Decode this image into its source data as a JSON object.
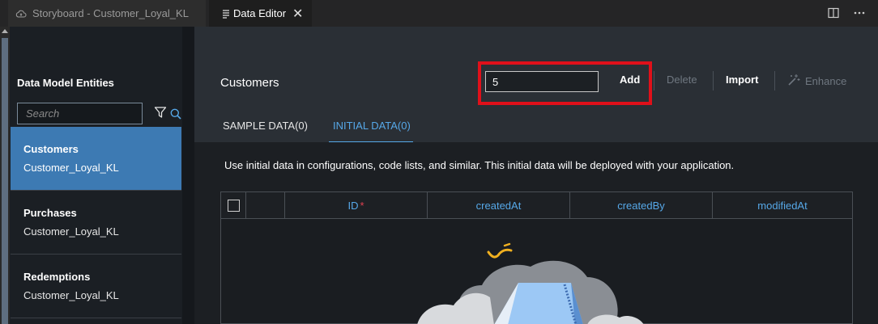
{
  "tabs": [
    {
      "label": "Storyboard - Customer_Loyal_KL",
      "active": false,
      "icon": "cloud-icon"
    },
    {
      "label": "Data Editor",
      "active": true,
      "icon": "document-icon"
    }
  ],
  "sidebar": {
    "title": "Data Model Entities",
    "search_placeholder": "Search",
    "entities": [
      {
        "name": "Customers",
        "subtitle": "Customer_Loyal_KL",
        "active": true
      },
      {
        "name": "Purchases",
        "subtitle": "Customer_Loyal_KL",
        "active": false
      },
      {
        "name": "Redemptions",
        "subtitle": "Customer_Loyal_KL",
        "active": false
      }
    ]
  },
  "main": {
    "title": "Customers",
    "quantity_value": "5",
    "buttons": {
      "add": "Add",
      "delete": "Delete",
      "import": "Import",
      "enhance": "Enhance"
    },
    "data_tabs": [
      {
        "label": "SAMPLE DATA(0)",
        "active": false
      },
      {
        "label": "INITIAL DATA(0)",
        "active": true
      }
    ],
    "info_text": "Use initial data in configurations, code lists, and similar. This initial data will be deployed with your application.",
    "table": {
      "columns": [
        "ID",
        "createdAt",
        "createdBy",
        "modifiedAt"
      ],
      "required_marker": "*"
    }
  },
  "colors": {
    "accent": "#56a8e8",
    "active_entity": "#3d7ab3",
    "highlight_box": "#e0101a"
  }
}
